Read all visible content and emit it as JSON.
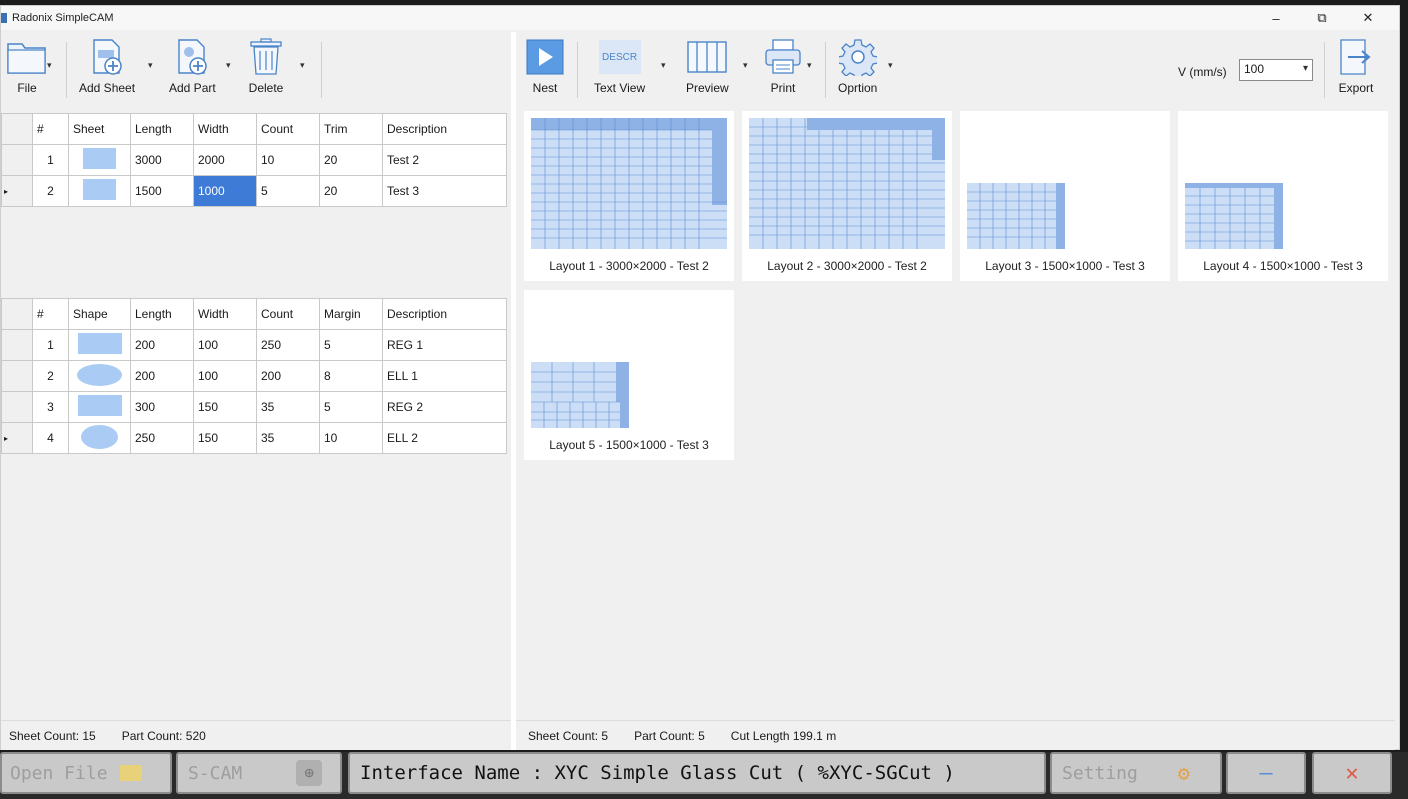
{
  "window": {
    "title": "Radonix SimpleCAM",
    "minimize": "–",
    "restore": "⧉",
    "close": "✕"
  },
  "left_toolbar": [
    {
      "id": "file",
      "label": "File"
    },
    {
      "id": "add_sheet",
      "label": "Add Sheet"
    },
    {
      "id": "add_part",
      "label": "Add Part"
    },
    {
      "id": "delete",
      "label": "Delete"
    }
  ],
  "right_toolbar": [
    {
      "id": "nest",
      "label": "Nest"
    },
    {
      "id": "text_view",
      "label": "Text View",
      "icon_text": "DESCR"
    },
    {
      "id": "preview",
      "label": "Preview"
    },
    {
      "id": "print",
      "label": "Print"
    },
    {
      "id": "option",
      "label": "Oprtion"
    },
    {
      "id": "export",
      "label": "Export"
    }
  ],
  "speed": {
    "label": "V (mm/s)",
    "value": "100"
  },
  "sheets_table": {
    "headers": [
      "#",
      "Sheet",
      "Length",
      "Width",
      "Count",
      "Trim",
      "Description"
    ],
    "rows": [
      {
        "n": "1",
        "length": "3000",
        "width": "2000",
        "count": "10",
        "trim": "20",
        "description": "Test 2",
        "current": false
      },
      {
        "n": "2",
        "length": "1500",
        "width": "1000",
        "count": "5",
        "trim": "20",
        "description": "Test 3",
        "current": true
      }
    ]
  },
  "parts_table": {
    "headers": [
      "#",
      "Shape",
      "Length",
      "Width",
      "Count",
      "Margin",
      "Description"
    ],
    "rows": [
      {
        "n": "1",
        "shape": "rectangle",
        "length": "200",
        "width": "100",
        "count": "250",
        "margin": "5",
        "description": "REG 1",
        "current": false
      },
      {
        "n": "2",
        "shape": "ellipse",
        "length": "200",
        "width": "100",
        "count": "200",
        "margin": "8",
        "description": "ELL 1",
        "current": false
      },
      {
        "n": "3",
        "shape": "rectangle",
        "length": "300",
        "width": "150",
        "count": "35",
        "margin": "5",
        "description": "REG 2",
        "current": false
      },
      {
        "n": "4",
        "shape": "ellipse",
        "length": "250",
        "width": "150",
        "count": "35",
        "margin": "10",
        "description": "ELL 2",
        "current": true
      }
    ]
  },
  "left_status": {
    "sheet_count": "Sheet Count: 15",
    "part_count": "Part Count: 520"
  },
  "layouts": [
    {
      "label": "Layout 1 - 3000×2000 - Test 2"
    },
    {
      "label": "Layout 2 - 3000×2000 - Test 2"
    },
    {
      "label": "Layout 3 - 1500×1000 - Test 3"
    },
    {
      "label": "Layout 4 - 1500×1000 - Test 3"
    },
    {
      "label": "Layout 5 - 1500×1000 - Test 3"
    }
  ],
  "right_status": {
    "sheet_count": "Sheet Count: 5",
    "part_count": "Part Count: 5",
    "cut_length": "Cut Length 199.1 m"
  },
  "taskbar": {
    "open_file": "Open File",
    "s_cam": "S-CAM",
    "interface_name": "Interface Name : XYC Simple Glass Cut ( %XYC-SGCut )",
    "setting": "Setting",
    "minimize": "—",
    "close": "✕"
  },
  "colors": {
    "accent": "#3d7bd6",
    "part_fill": "#aacbf3",
    "sheet_bar": "#7fa6e0"
  },
  "row_marker": "▸",
  "dropdown_arrow": "▾"
}
